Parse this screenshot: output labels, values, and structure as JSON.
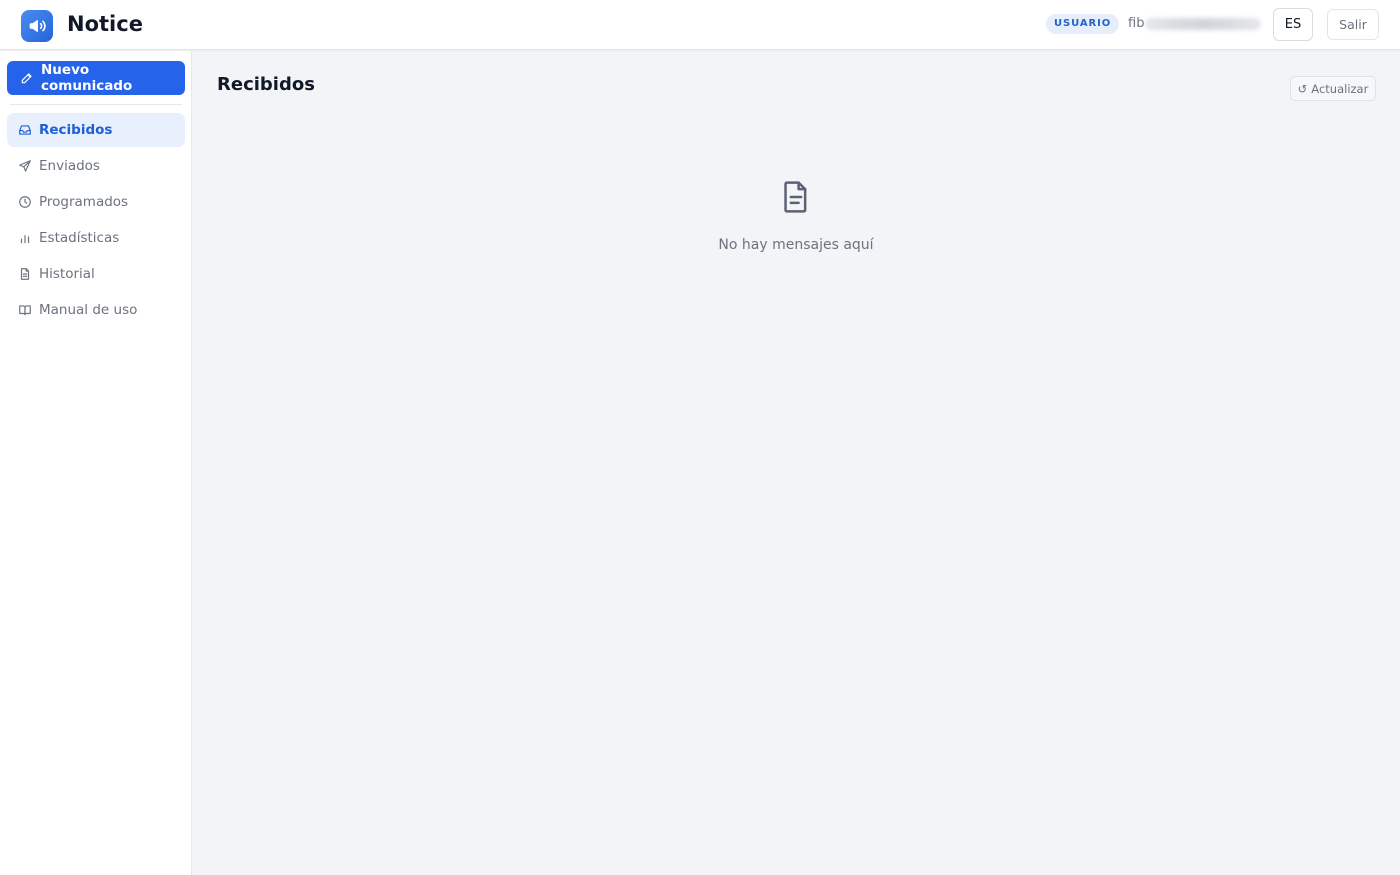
{
  "app": {
    "title": "Notice",
    "logo_icon": "megaphone-icon",
    "accent_color": "#2563eb"
  },
  "header": {
    "role_badge": "USUARIO",
    "user_email_visible": "fib",
    "language": "ES",
    "logout_label": "Salir"
  },
  "sidebar": {
    "new_button": {
      "label": "Nuevo comunicado",
      "icon": "pencil-icon"
    },
    "items": [
      {
        "label": "Recibidos",
        "icon": "inbox-icon",
        "active": true
      },
      {
        "label": "Enviados",
        "icon": "send-icon",
        "active": false
      },
      {
        "label": "Programados",
        "icon": "clock-icon",
        "active": false
      },
      {
        "label": "Estadísticas",
        "icon": "bar-chart-icon",
        "active": false
      },
      {
        "label": "Historial",
        "icon": "document-icon",
        "active": false
      },
      {
        "label": "Manual de uso",
        "icon": "book-icon",
        "active": false
      }
    ]
  },
  "main": {
    "title": "Recibidos",
    "refresh": {
      "icon": "↺",
      "label": "Actualizar"
    },
    "empty_state": {
      "icon": "document-icon",
      "text": "No hay mensajes aquí"
    }
  }
}
